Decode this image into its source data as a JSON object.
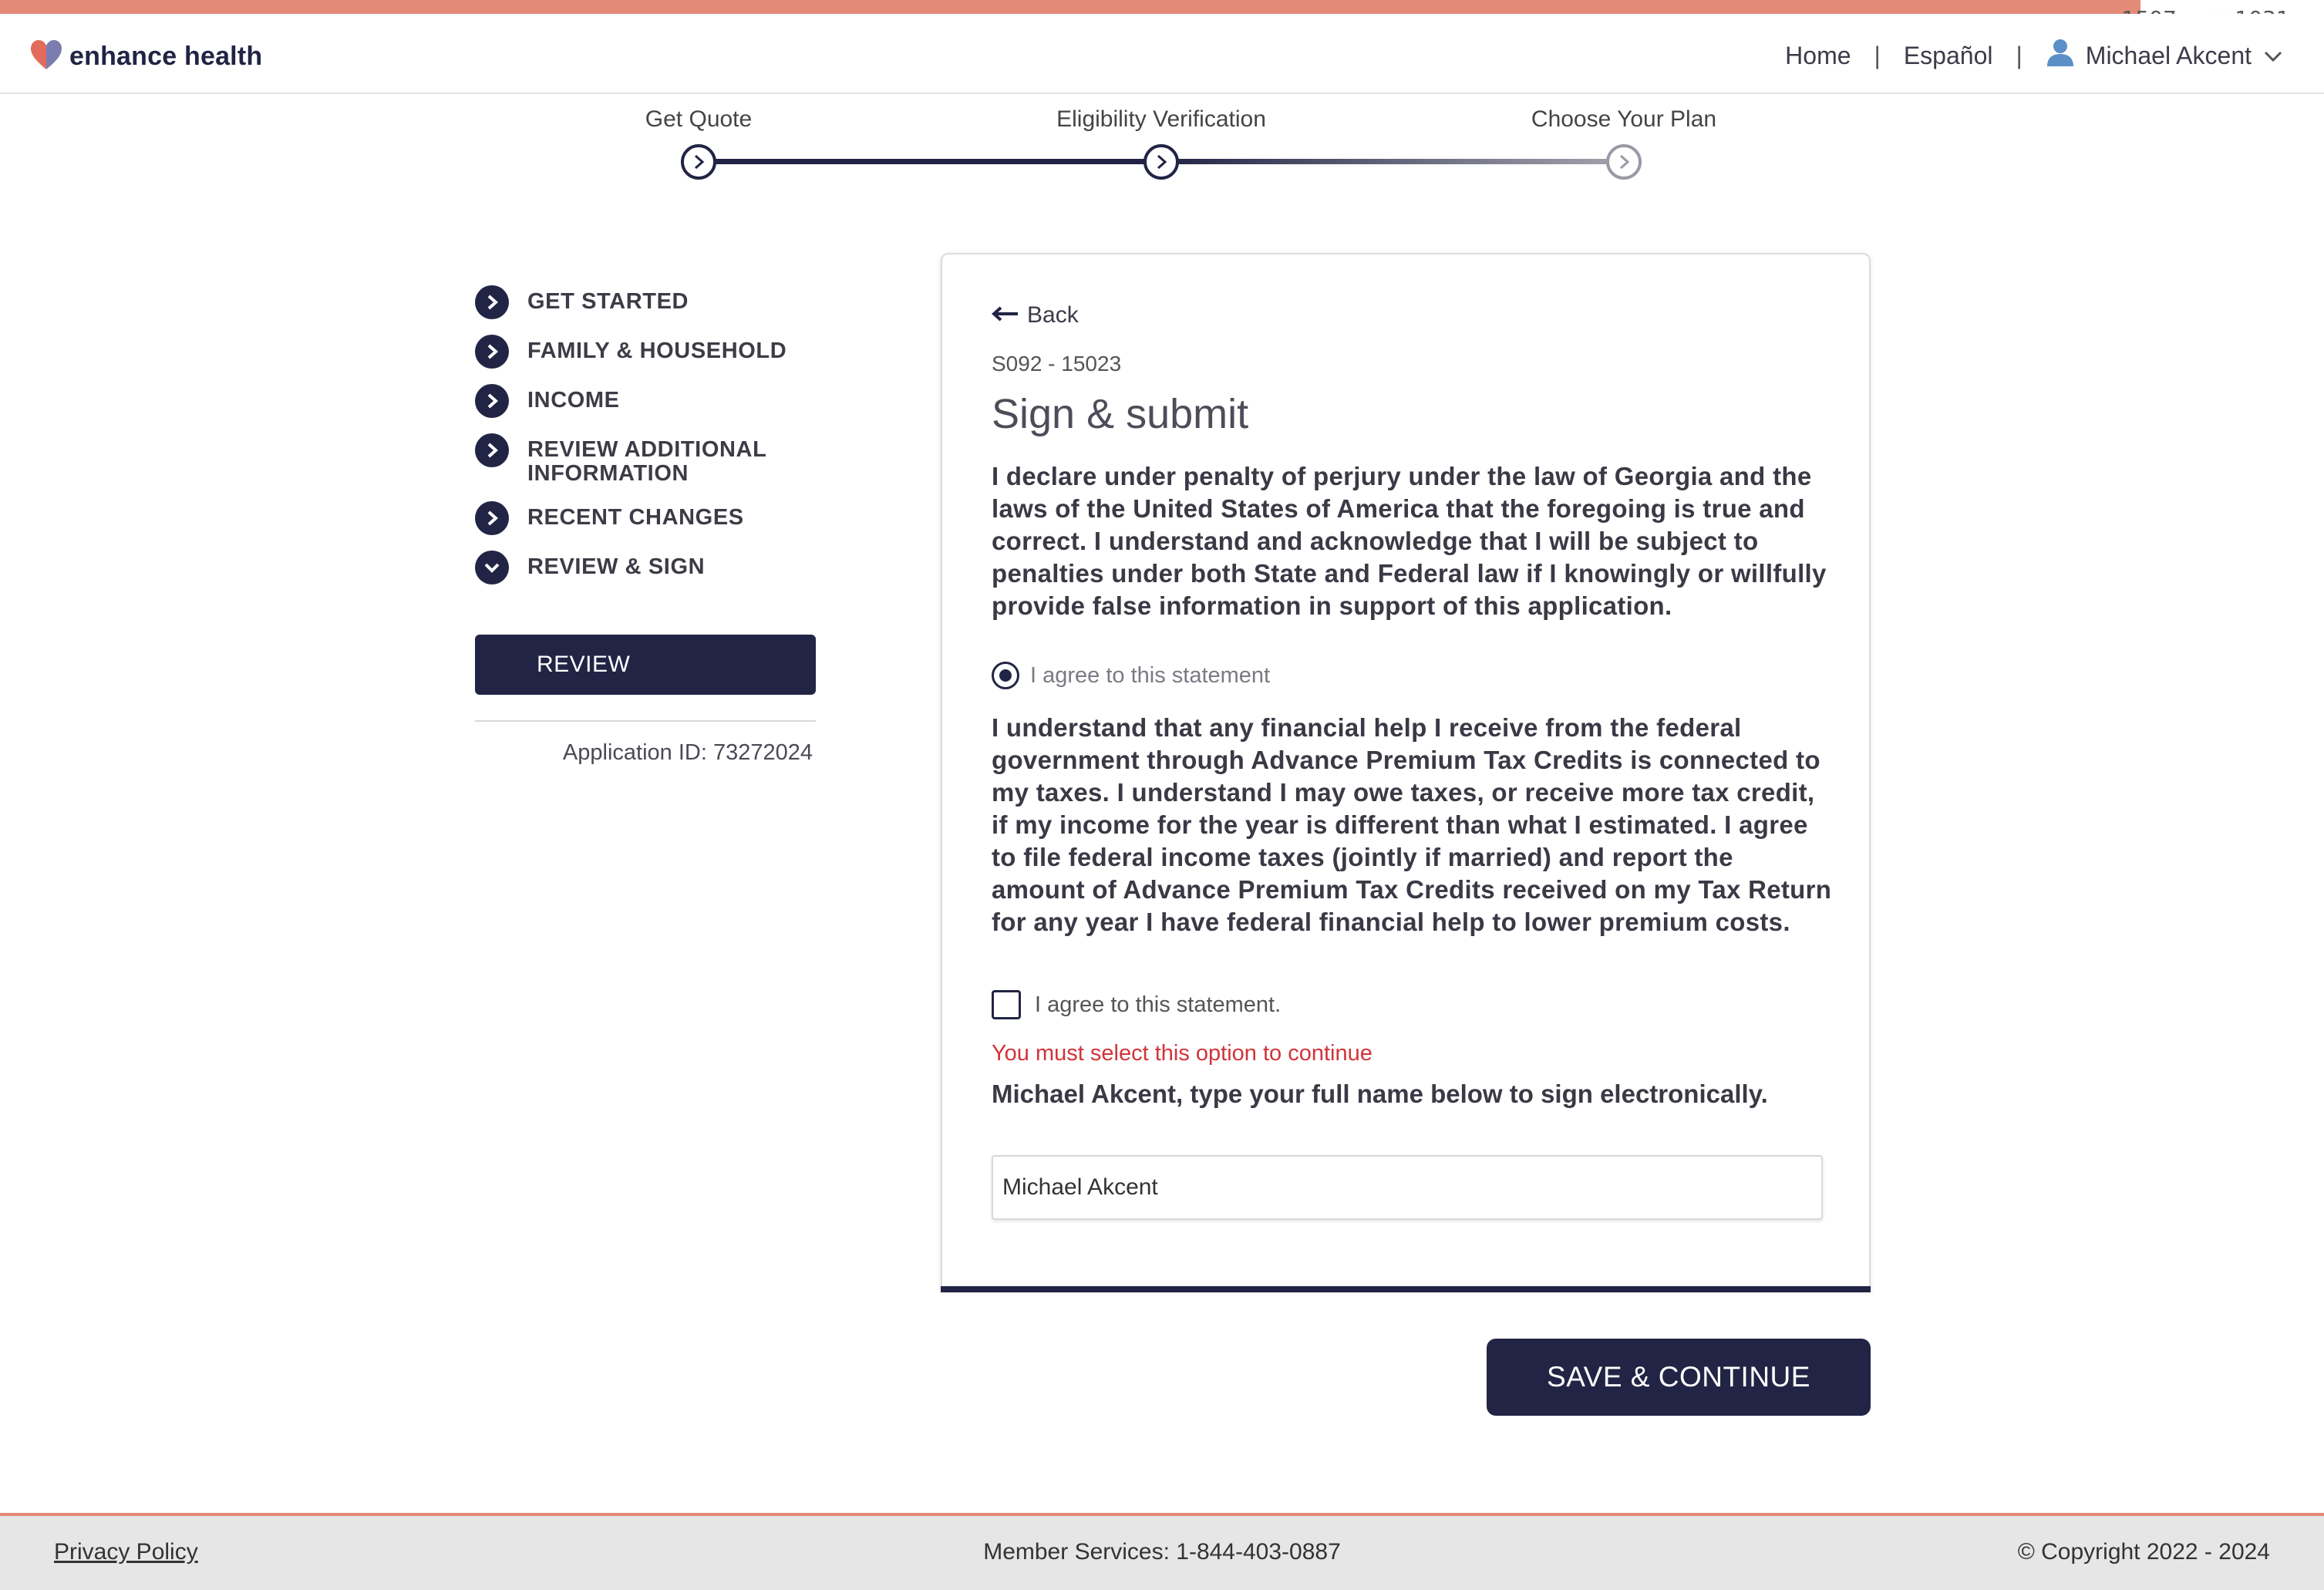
{
  "brand": {
    "name": "enhance health",
    "accent": "#e38a78",
    "primary": "#222445",
    "error": "#d2333a"
  },
  "dimension_label": "1507px × 1031px",
  "header": {
    "nav_home": "Home",
    "separator": "|",
    "nav_language": "Español",
    "user_name": "Michael Akcent",
    "user_icon": "user-icon",
    "dropdown_icon": "chevron-down-icon"
  },
  "progress": {
    "steps": [
      {
        "label": "Get Quote",
        "state": "complete"
      },
      {
        "label": "Eligibility Verification",
        "state": "current"
      },
      {
        "label": "Choose Your Plan",
        "state": "upcoming"
      }
    ]
  },
  "sidebar": {
    "items": [
      {
        "label": "GET STARTED",
        "icon": "chevron-right-icon"
      },
      {
        "label": "FAMILY & HOUSEHOLD",
        "icon": "chevron-right-icon"
      },
      {
        "label": "INCOME",
        "icon": "chevron-right-icon"
      },
      {
        "label": "REVIEW ADDITIONAL INFORMATION",
        "icon": "chevron-right-icon"
      },
      {
        "label": "RECENT CHANGES",
        "icon": "chevron-right-icon"
      },
      {
        "label": "REVIEW & SIGN",
        "icon": "chevron-down-icon"
      }
    ],
    "active_sub_item": "REVIEW",
    "application_id": "Application ID: 73272024"
  },
  "form": {
    "back_label": "Back",
    "code": "S092 - 15023",
    "title": "Sign & submit",
    "declaration_1": "I declare under penalty of perjury under the law of Georgia and the laws of the United States of America that the foregoing is true and correct. I understand and acknowledge that I will be subject to penalties under both State and Federal law if I knowingly or willfully provide false information in support of this application.",
    "agree_1_label": "I agree to this statement",
    "agree_1_checked": true,
    "declaration_2": "I understand that any financial help I receive from the federal government through Advance Premium Tax Credits is connected to my taxes. I understand I may owe taxes, or receive more tax credit, if my income for the year is different than what I estimated. I agree to file federal income taxes (jointly if married) and report the amount of Advance Premium Tax Credits received on my Tax Return for any year I have federal financial help to lower premium costs.",
    "agree_2_label": "I agree to this statement.",
    "agree_2_checked": false,
    "error_message": "You must select this option to continue",
    "sign_label": "Michael Akcent, type your full name below to sign electronically.",
    "signature_value": "Michael Akcent",
    "save_label": "SAVE & CONTINUE"
  },
  "footer": {
    "privacy": "Privacy Policy",
    "member_services": "Member Services: 1-844-403-0887",
    "copyright": "© Copyright 2022 - 2024"
  }
}
